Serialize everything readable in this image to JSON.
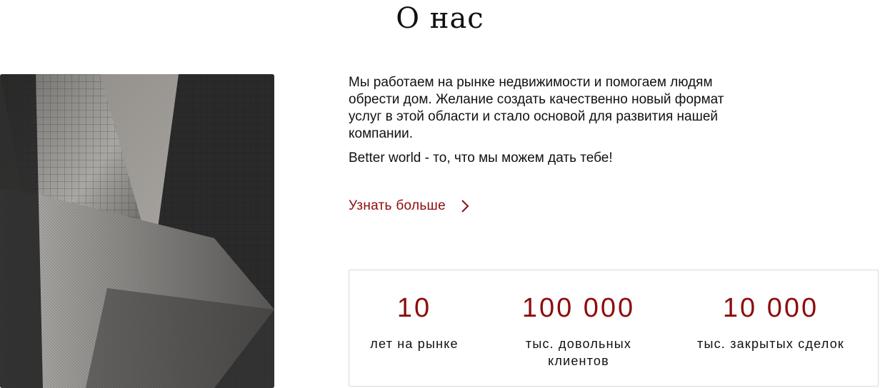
{
  "about": {
    "title": "О нас",
    "paragraph1": "Мы работаем на рынке недвижимости и помогаем людям обрести дом. Желание создать качественно новый формат услуг в этой области и стало основой для развития нашей компании.",
    "paragraph2": "Better world - то, что мы можем дать тебе!",
    "more_label": "Узнать больше"
  },
  "stats": [
    {
      "value": "10",
      "label": "лет на рынке"
    },
    {
      "value": "100 000",
      "label": "тыс. довольных клиентов"
    },
    {
      "value": "10 000",
      "label": "тыс. закрытых сделок"
    }
  ],
  "colors": {
    "accent": "#8e0c0c",
    "text": "#111111",
    "border": "#d9d9d9"
  },
  "icons": {
    "more_link": "chevron-right-icon"
  }
}
